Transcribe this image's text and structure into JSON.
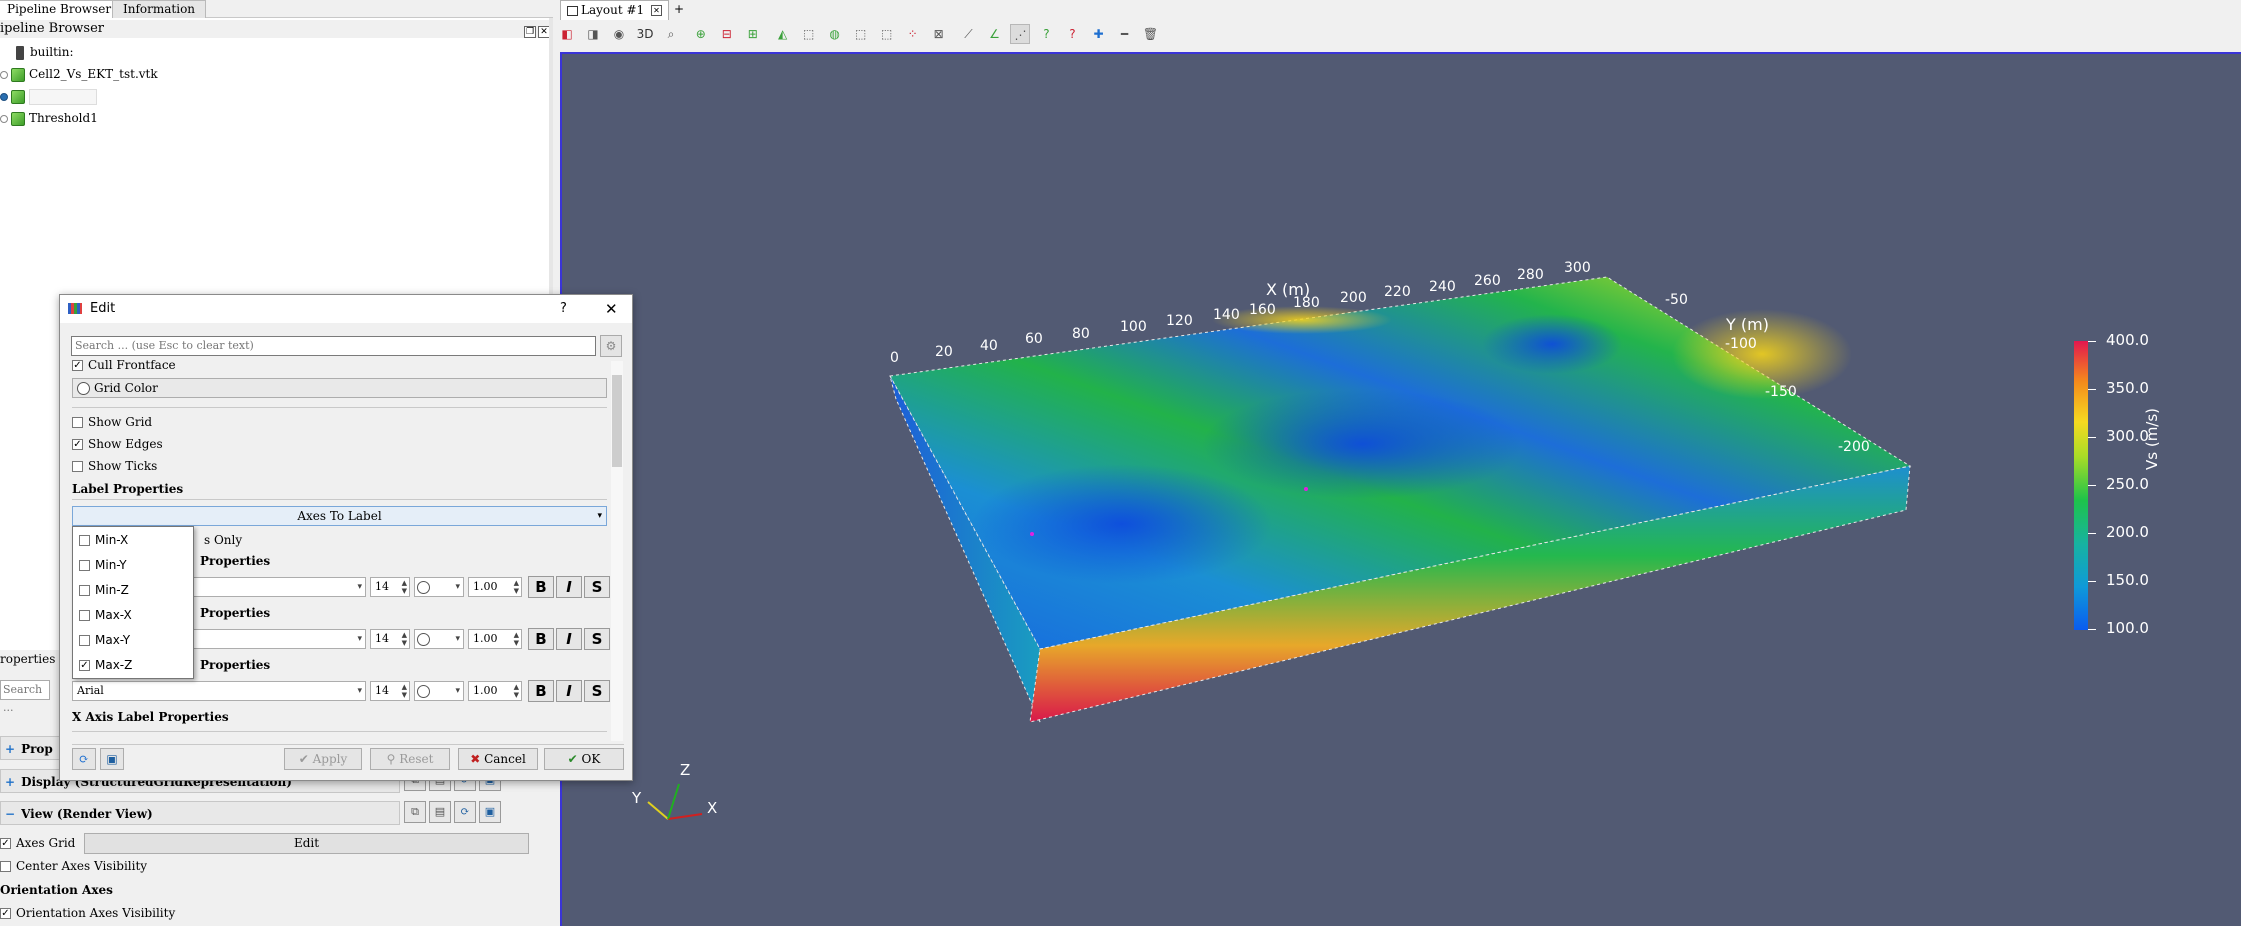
{
  "left": {
    "tabs": [
      "Pipeline Browser",
      "Information"
    ],
    "pipeline_title": "ipeline Browser",
    "pipeline": {
      "server": "builtin:",
      "items": [
        "Cell2_Vs_EKT_tst.vtk",
        "",
        "Threshold1"
      ]
    },
    "properties_tab": "roperties",
    "search_placeholder": "Search ...",
    "sections": {
      "prop": "Prop",
      "display": "Display (StructuredGridRepresentation)",
      "view": "View (Render View)"
    },
    "rows": {
      "axes_grid": "Axes Grid",
      "edit": "Edit",
      "center_axes": "Center Axes Visibility",
      "orientation_axes": "Orientation Axes",
      "orientation_axes_visibility": "Orientation Axes Visibility"
    }
  },
  "render": {
    "layout_tab": "Layout #1",
    "plus_tab": "+",
    "toolbar_3d": "3D",
    "x_axis_title": "X (m)",
    "y_axis_title": "Y (m)",
    "x_ticks": [
      "0",
      "20",
      "40",
      "60",
      "80",
      "100",
      "120",
      "140",
      "160",
      "180",
      "200",
      "220",
      "240",
      "260",
      "280",
      "300"
    ],
    "y_ticks": [
      "-50",
      "-100",
      "-150",
      "-200"
    ],
    "scalar_bar": {
      "title": "Vs (m/s)",
      "ticks": [
        "400.0",
        "350.0",
        "300.0",
        "250.0",
        "200.0",
        "150.0",
        "100.0"
      ],
      "colors": [
        "#0a5cf0",
        "#17b3a0",
        "#1ec34a",
        "#f6da20",
        "#e2174f"
      ]
    },
    "orientation": {
      "x": "X",
      "y": "Y",
      "z": "Z"
    },
    "background": "#525a73"
  },
  "dialog": {
    "title": "Edit",
    "help": "?",
    "close": "✕",
    "search_placeholder": "Search ... (use Esc to clear text)",
    "cull_frontface": "Cull Frontface",
    "grid_color": "Grid Color",
    "show_grid": "Show Grid",
    "show_edges": "Show Edges",
    "show_ticks": "Show Ticks",
    "label_properties": "Label Properties",
    "axes_to_label": "Axes To Label",
    "faces_only": "s Only",
    "x_props": "Properties",
    "y_props": "Properties",
    "z_props": "Properties",
    "x_axis_label_props": "X Axis Label Properties",
    "font": "Arial",
    "size": "14",
    "opacity": "1.00",
    "bold": "B",
    "italic": "I",
    "shadow": "S",
    "popup": [
      "Min-X",
      "Min-Y",
      "Min-Z",
      "Max-X",
      "Max-Y",
      "Max-Z"
    ],
    "apply": "Apply",
    "reset": "Reset",
    "cancel": "Cancel",
    "ok": "OK"
  }
}
